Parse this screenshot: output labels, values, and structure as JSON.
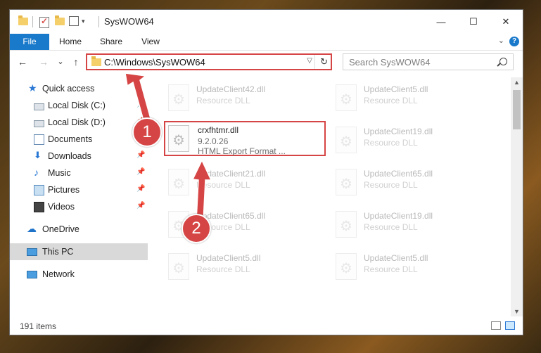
{
  "window": {
    "title": "SysWOW64",
    "controls": {
      "minimize": "—",
      "maximize": "☐",
      "close": "✕"
    }
  },
  "ribbon": {
    "tabs": [
      "File",
      "Home",
      "Share",
      "View"
    ]
  },
  "navbar": {
    "back": "←",
    "forward": "→",
    "recent": "⌄",
    "up": "↑",
    "address": "C:\\Windows\\SysWOW64",
    "search_placeholder": "Search SysWOW64"
  },
  "sidebar": {
    "items": [
      {
        "label": "Quick access",
        "icon": "star-icon"
      },
      {
        "label": "Local Disk (C:)",
        "icon": "disk-icon"
      },
      {
        "label": "Local Disk (D:)",
        "icon": "disk-icon"
      },
      {
        "label": "Documents",
        "icon": "documents-icon"
      },
      {
        "label": "Downloads",
        "icon": "download-icon"
      },
      {
        "label": "Music",
        "icon": "music-icon"
      },
      {
        "label": "Pictures",
        "icon": "pictures-icon"
      },
      {
        "label": "Videos",
        "icon": "videos-icon"
      },
      {
        "label": "OneDrive",
        "icon": "cloud-icon"
      },
      {
        "label": "This PC",
        "icon": "computer-icon"
      },
      {
        "label": "Network",
        "icon": "network-icon"
      }
    ]
  },
  "files": {
    "highlighted": {
      "name": "crxfhtmr.dll",
      "version": "9.2.0.26",
      "description": "HTML Export Format ..."
    },
    "left_column": [
      {
        "name": "UpdateClient42.dll",
        "type": "Resource DLL"
      },
      {
        "name": "UpdateClient21.dll",
        "type": "Resource DLL"
      },
      {
        "name": "UpdateClient65.dll",
        "type": "Resource DLL"
      },
      {
        "name": "UpdateClient5.dll",
        "type": "Resource DLL"
      }
    ],
    "right_column": [
      {
        "name": "UpdateClient5.dll",
        "type": "Resource DLL"
      },
      {
        "name": "UpdateClient19.dll",
        "type": "Resource DLL"
      },
      {
        "name": "UpdateClient65.dll",
        "type": "Resource DLL"
      },
      {
        "name": "UpdateClient19.dll",
        "type": "Resource DLL"
      },
      {
        "name": "UpdateClient5.dll",
        "type": "Resource DLL"
      }
    ]
  },
  "status": {
    "item_count": "191 items"
  },
  "annotations": {
    "badge1": "1",
    "badge2": "2",
    "color": "#d64545"
  }
}
